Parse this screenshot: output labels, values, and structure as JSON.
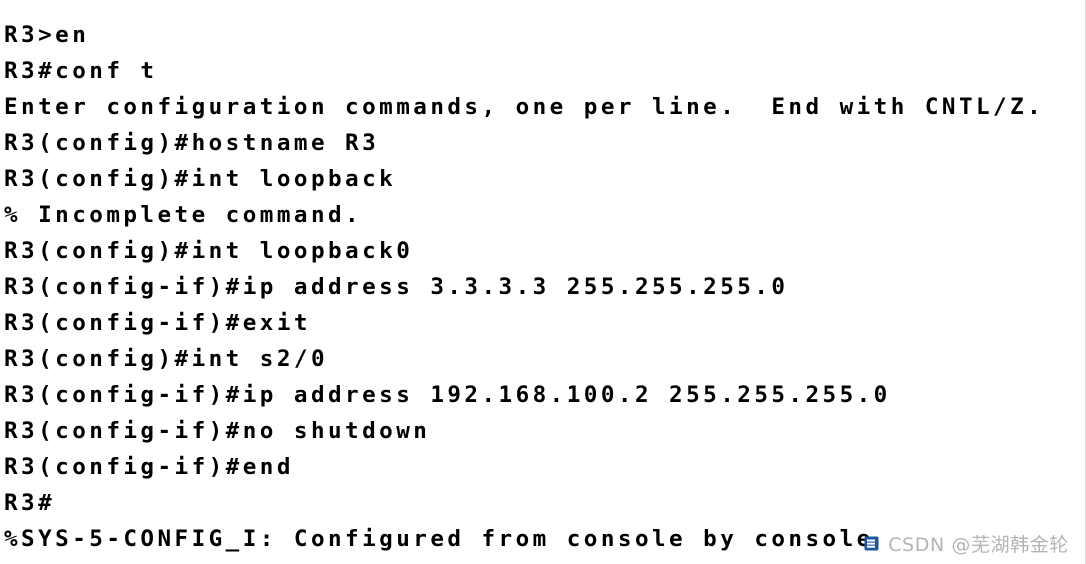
{
  "terminal": {
    "device_hostname": "R3",
    "background_color": "#ffffff",
    "text_color": "#000000",
    "lines": [
      {
        "text": "R3>en"
      },
      {
        "text": "R3#conf t"
      },
      {
        "text": "Enter configuration commands, one per line.  End with CNTL/Z."
      },
      {
        "text": "R3(config)#hostname R3"
      },
      {
        "text": "R3(config)#int loopback"
      },
      {
        "text": "% Incomplete command."
      },
      {
        "text": "R3(config)#int loopback0"
      },
      {
        "text": "R3(config-if)#ip address 3.3.3.3 255.255.255.0"
      },
      {
        "text": "R3(config-if)#exit"
      },
      {
        "text": "R3(config)#int s2/0"
      },
      {
        "text": "R3(config-if)#ip address 192.168.100.2 255.255.255.0"
      },
      {
        "text": "R3(config-if)#no shutdown"
      },
      {
        "text": "R3(config-if)#end"
      },
      {
        "text": "R3#"
      },
      {
        "text": "%SYS-5-CONFIG_I: Configured from console by console"
      }
    ]
  },
  "watermark": {
    "icon": "csdn-logo-icon",
    "text": "CSDN @芜湖韩金轮",
    "color": "#b4b4b4",
    "logo_color": "#1f54a0"
  }
}
